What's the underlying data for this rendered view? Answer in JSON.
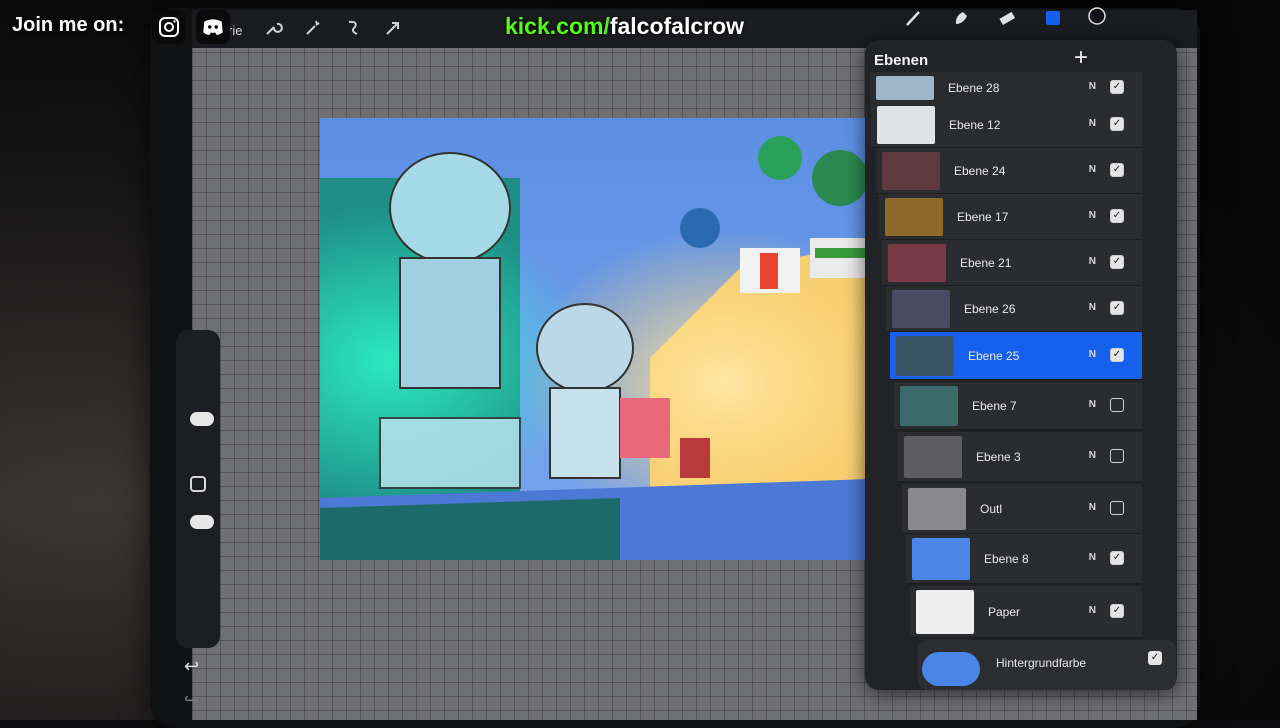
{
  "overlay": {
    "join_label": "Join me on:",
    "kick_domain": "kick.com/",
    "kick_handle": "falcofalcrow",
    "social_icons": [
      "instagram-icon",
      "discord-icon"
    ],
    "kick_color": "#53fc18"
  },
  "toolbar": {
    "gallery_label": "rie",
    "left_tools": [
      "wrench-icon",
      "magic-wand-icon",
      "selection-icon",
      "transform-arrow-icon"
    ],
    "right_tools": [
      "brush-icon",
      "smudge-icon",
      "eraser-icon",
      "layers-icon",
      "color-icon"
    ]
  },
  "layers_panel": {
    "title": "Ebenen",
    "add_label": "+",
    "accent": "#1660ee",
    "layers": [
      {
        "name": "Ebene 28",
        "blend": "N",
        "visible": true
      },
      {
        "name": "Ebene 12",
        "blend": "N",
        "visible": true
      },
      {
        "name": "Ebene 24",
        "blend": "N",
        "visible": true
      },
      {
        "name": "Ebene 17",
        "blend": "N",
        "visible": true
      },
      {
        "name": "Ebene 21",
        "blend": "N",
        "visible": true
      },
      {
        "name": "Ebene 26",
        "blend": "N",
        "visible": true
      },
      {
        "name": "Ebene 25",
        "blend": "N",
        "visible": true,
        "active": true
      },
      {
        "name": "Ebene 7",
        "blend": "N",
        "visible": false
      },
      {
        "name": "Ebene 3",
        "blend": "N",
        "visible": false
      },
      {
        "name": "Outl",
        "blend": "N",
        "visible": false
      },
      {
        "name": "Ebene 8",
        "blend": "N",
        "visible": true
      },
      {
        "name": "Paper",
        "blend": "N",
        "visible": true
      }
    ],
    "background": {
      "name": "Hintergrundfarbe",
      "visible": true,
      "color": "#4a86e8"
    }
  },
  "sidebar": {
    "undo_label": "↩",
    "redo_label": "↪"
  }
}
